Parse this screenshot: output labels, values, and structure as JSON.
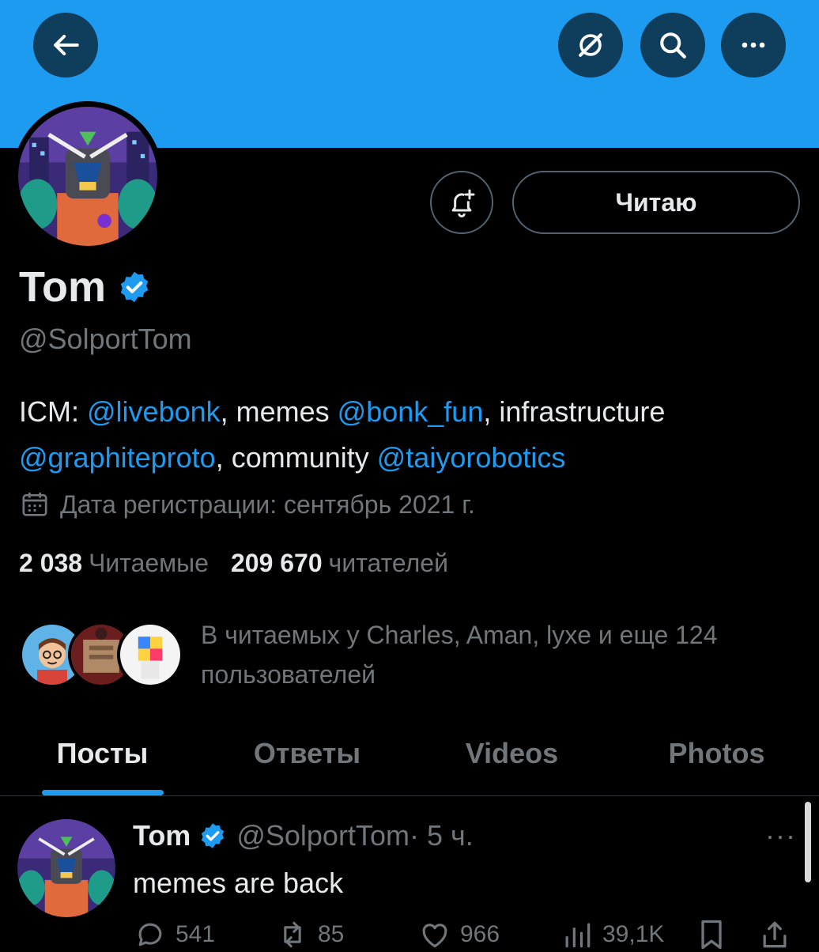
{
  "header": {
    "back_icon": "arrow-left-icon",
    "grok_icon": "grok-icon",
    "search_icon": "search-icon",
    "more_icon": "more-icon"
  },
  "profile": {
    "name": "Tom",
    "handle": "@SolportTom",
    "follow_button": "Читаю",
    "bio": {
      "p1": "ICM: ",
      "l1": "@livebonk",
      "p2": ", memes ",
      "l2": "@bonk_fun",
      "p3": ", infrastructure ",
      "l3": "@graphiteproto",
      "p4": ", community ",
      "l4": "@taiyorobotics"
    },
    "joined": "Дата регистрации: сентябрь 2021 г.",
    "following_count": "2 038",
    "following_label": "Читаемые",
    "followers_count": "209 670",
    "followers_label": "читателей",
    "known_followers": "В читаемых у Charles, Aman, lyxe и еще 124 пользователей"
  },
  "tabs": [
    {
      "label": "Посты"
    },
    {
      "label": "Ответы"
    },
    {
      "label": "Videos"
    },
    {
      "label": "Photos"
    }
  ],
  "post": {
    "name": "Tom",
    "handle": "@SolportTom",
    "time": "· 5 ч.",
    "more": "···",
    "text": "memes are back",
    "replies": "541",
    "reposts": "85",
    "likes": "966",
    "views": "39,1K"
  },
  "colors": {
    "accent": "#1d9bf0",
    "banner": "#1d9bf0",
    "background": "#000000",
    "muted_text": "#71767b"
  }
}
